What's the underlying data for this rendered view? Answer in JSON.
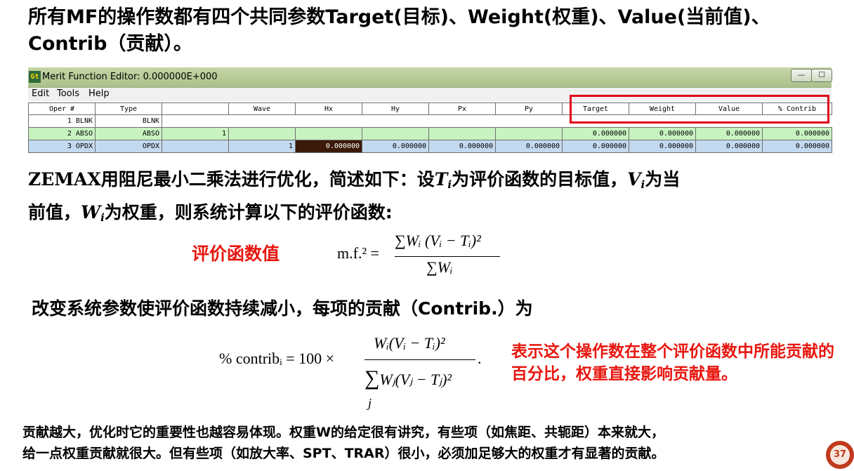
{
  "title": {
    "line1": "所有MF的操作数都有四个共同参数Target(目标)、Weight(权重)、Value(当前值)、",
    "line2": "Contrib（贡献）。"
  },
  "window": {
    "icon": "Gt",
    "title": "Merit Function Editor: 0.000000E+000",
    "minimize": "—",
    "maximize": "☐",
    "menu": [
      "Edit",
      "Tools",
      "Help"
    ]
  },
  "table": {
    "headers": [
      "Oper #",
      "Type",
      "",
      "Wave",
      "Hx",
      "Hy",
      "Px",
      "Py",
      "Target",
      "Weight",
      "Value",
      "% Contrib"
    ],
    "rows": [
      [
        "1 BLNK",
        "BLNK"
      ],
      [
        "2 ABSO",
        "ABSO",
        "1",
        "",
        "",
        "",
        "",
        "",
        "0.000000",
        "0.000000",
        "0.000000",
        "0.000000"
      ],
      [
        "3 OPDX",
        "OPDX",
        "",
        "1",
        "0.000000",
        "0.000000",
        "0.000000",
        "0.000000",
        "0.000000",
        "0.000000",
        "0.000000",
        "0.000000"
      ]
    ]
  },
  "paragraph1": {
    "a": "ZEMAX",
    "b": "用阻尼最小二乘法进行优化，简述如下：设",
    "T": "T",
    "i1": "i",
    "c": "为评价函数的目标值，",
    "V": "V",
    "i2": "i",
    "d": "为当",
    "e": "前值，",
    "W": "W",
    "i3": "i",
    "f": "为权重，则系统计算以下的评价函数:"
  },
  "mf_label": "评价函数值",
  "formula1": {
    "lhs": "m.f.² =",
    "numerator": "∑Wᵢ (Vᵢ − Tᵢ)²",
    "denominator": "∑Wᵢ"
  },
  "paragraph2": "改变系统参数使评价函数持续减小，每项的贡献（Contrib.）为",
  "formula2": {
    "lhs": "% contribᵢ  =  100 ×",
    "numerator": "Wᵢ(Vᵢ − Tᵢ)²",
    "sigma": "∑",
    "denominator": "Wⱼ(Vⱼ − Tⱼ)²",
    "index": "j",
    "dot": "."
  },
  "note": "表示这个操作数在整个评价函数中所能贡献的百分比，权重直接影响贡献量。",
  "bottom": {
    "line1": "贡献越大，优化时它的重要性也越容易体现。权重W的给定很有讲究，有些项（如焦距、共轭距）本来就大，",
    "line2": "给一点权重贡献就很大。但有些项（如放大率、SPT、TRAR）很小，必须加足够大的权重才有显著的贡献。"
  },
  "page_number": "37"
}
